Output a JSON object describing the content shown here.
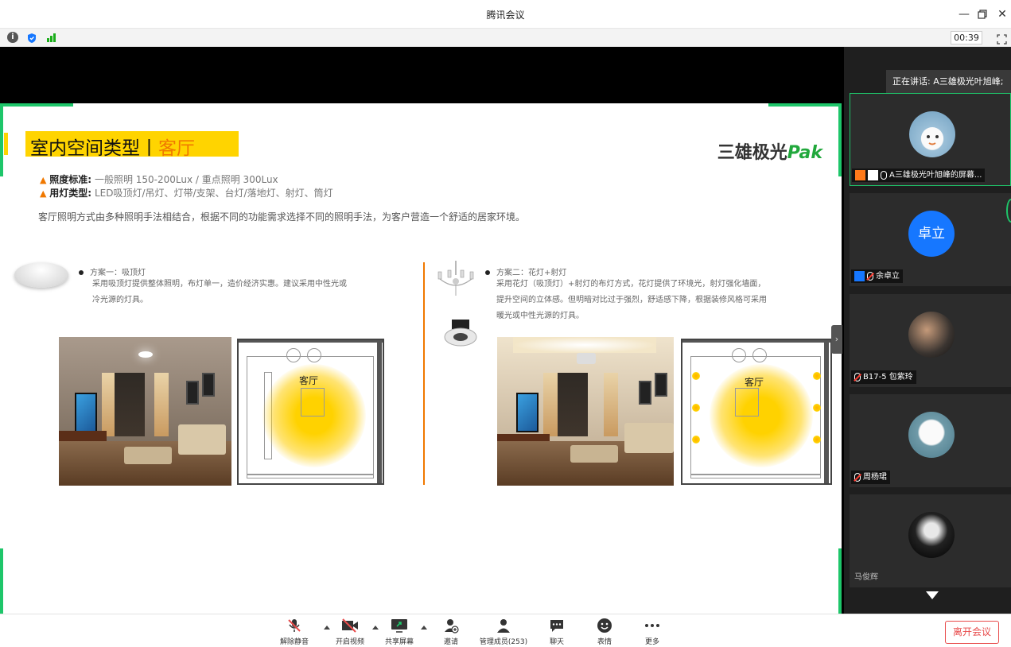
{
  "window": {
    "title": "腾讯会议",
    "timer": "00:39"
  },
  "slide": {
    "title_main": "室内空间类型",
    "title_sep": "丨",
    "title_highlight": "客厅",
    "brand_text": "三雄极光",
    "brand_logo": "Pak",
    "standard_label": "照度标准:",
    "standard_value": "一般照明 150-200Lux / 重点照明 300Lux",
    "lamp_label": "用灯类型:",
    "lamp_value": "LED吸顶灯/吊灯、灯带/支架、台灯/落地灯、射灯、筒灯",
    "intro": "客厅照明方式由多种照明手法相结合，根据不同的功能需求选择不同的照明手法，为客户营造一个舒适的居家环境。",
    "plan1": {
      "head": "方案一：吸顶灯",
      "line1": "采用吸顶灯提供整体照明，布灯单一，造价经济实惠。建议采用中性光或",
      "line2": "冷光源的灯具。"
    },
    "plan2": {
      "head": "方案二：花灯+射灯",
      "line1": "采用花灯（吸顶灯）+射灯的布灯方式，花灯提供了环境光，射灯强化墙面，",
      "line2": "提升空间的立体感。但明暗对比过于强烈，舒适感下降，根据装修风格可采用",
      "line3": "暖光或中性光源的灯具。"
    },
    "room_label": "客厅"
  },
  "panel": {
    "speaking": "正在讲话: A三雄极光叶旭峰;",
    "participants": [
      {
        "name": "A三雄极光叶旭峰的屏幕..."
      },
      {
        "name": "余卓立",
        "avatar_text": "卓立"
      },
      {
        "name": "B17-5 包紫玲"
      },
      {
        "name": "周杨珺"
      },
      {
        "name": "马俊辉"
      }
    ]
  },
  "toolbar": {
    "unmute": "解除静音",
    "video": "开启视频",
    "share": "共享屏幕",
    "invite": "邀请",
    "members": "管理成员(253)",
    "chat": "聊天",
    "emoji": "表情",
    "more": "更多",
    "leave": "离开会议"
  },
  "colors": {
    "accent_green": "#1ec66a",
    "slide_yellow": "#ffd400",
    "slide_orange": "#f07800",
    "leave_red": "#e84b4b",
    "avatar_blue": "#1677ff"
  }
}
